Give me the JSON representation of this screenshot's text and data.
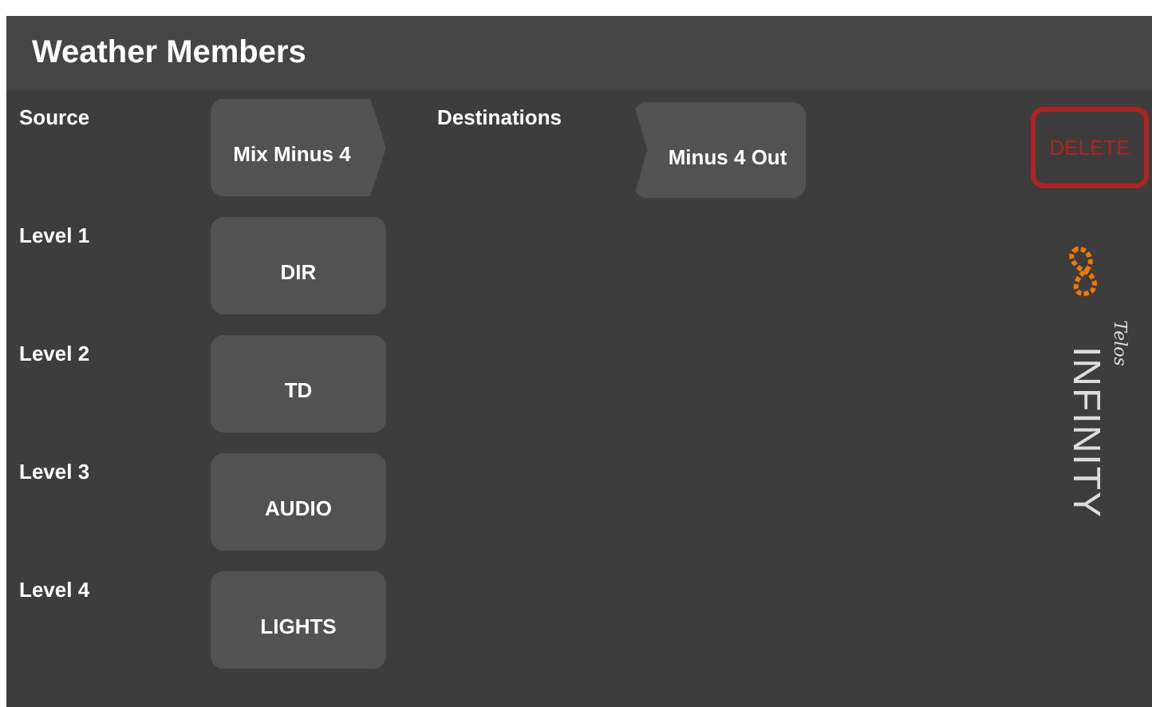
{
  "title": "Weather Members",
  "source": {
    "label": "Source",
    "button": "Mix Minus 4"
  },
  "destinations": {
    "label": "Destinations",
    "buttons": [
      "Minus 4 Out"
    ]
  },
  "levels": [
    {
      "label": "Level 1",
      "button": "DIR"
    },
    {
      "label": "Level 2",
      "button": "TD"
    },
    {
      "label": "Level 3",
      "button": "AUDIO"
    },
    {
      "label": "Level 4",
      "button": "LIGHTS"
    }
  ],
  "delete_button": "DELETE",
  "logo": {
    "script": "Telos",
    "wordmark": "INFINITY"
  }
}
